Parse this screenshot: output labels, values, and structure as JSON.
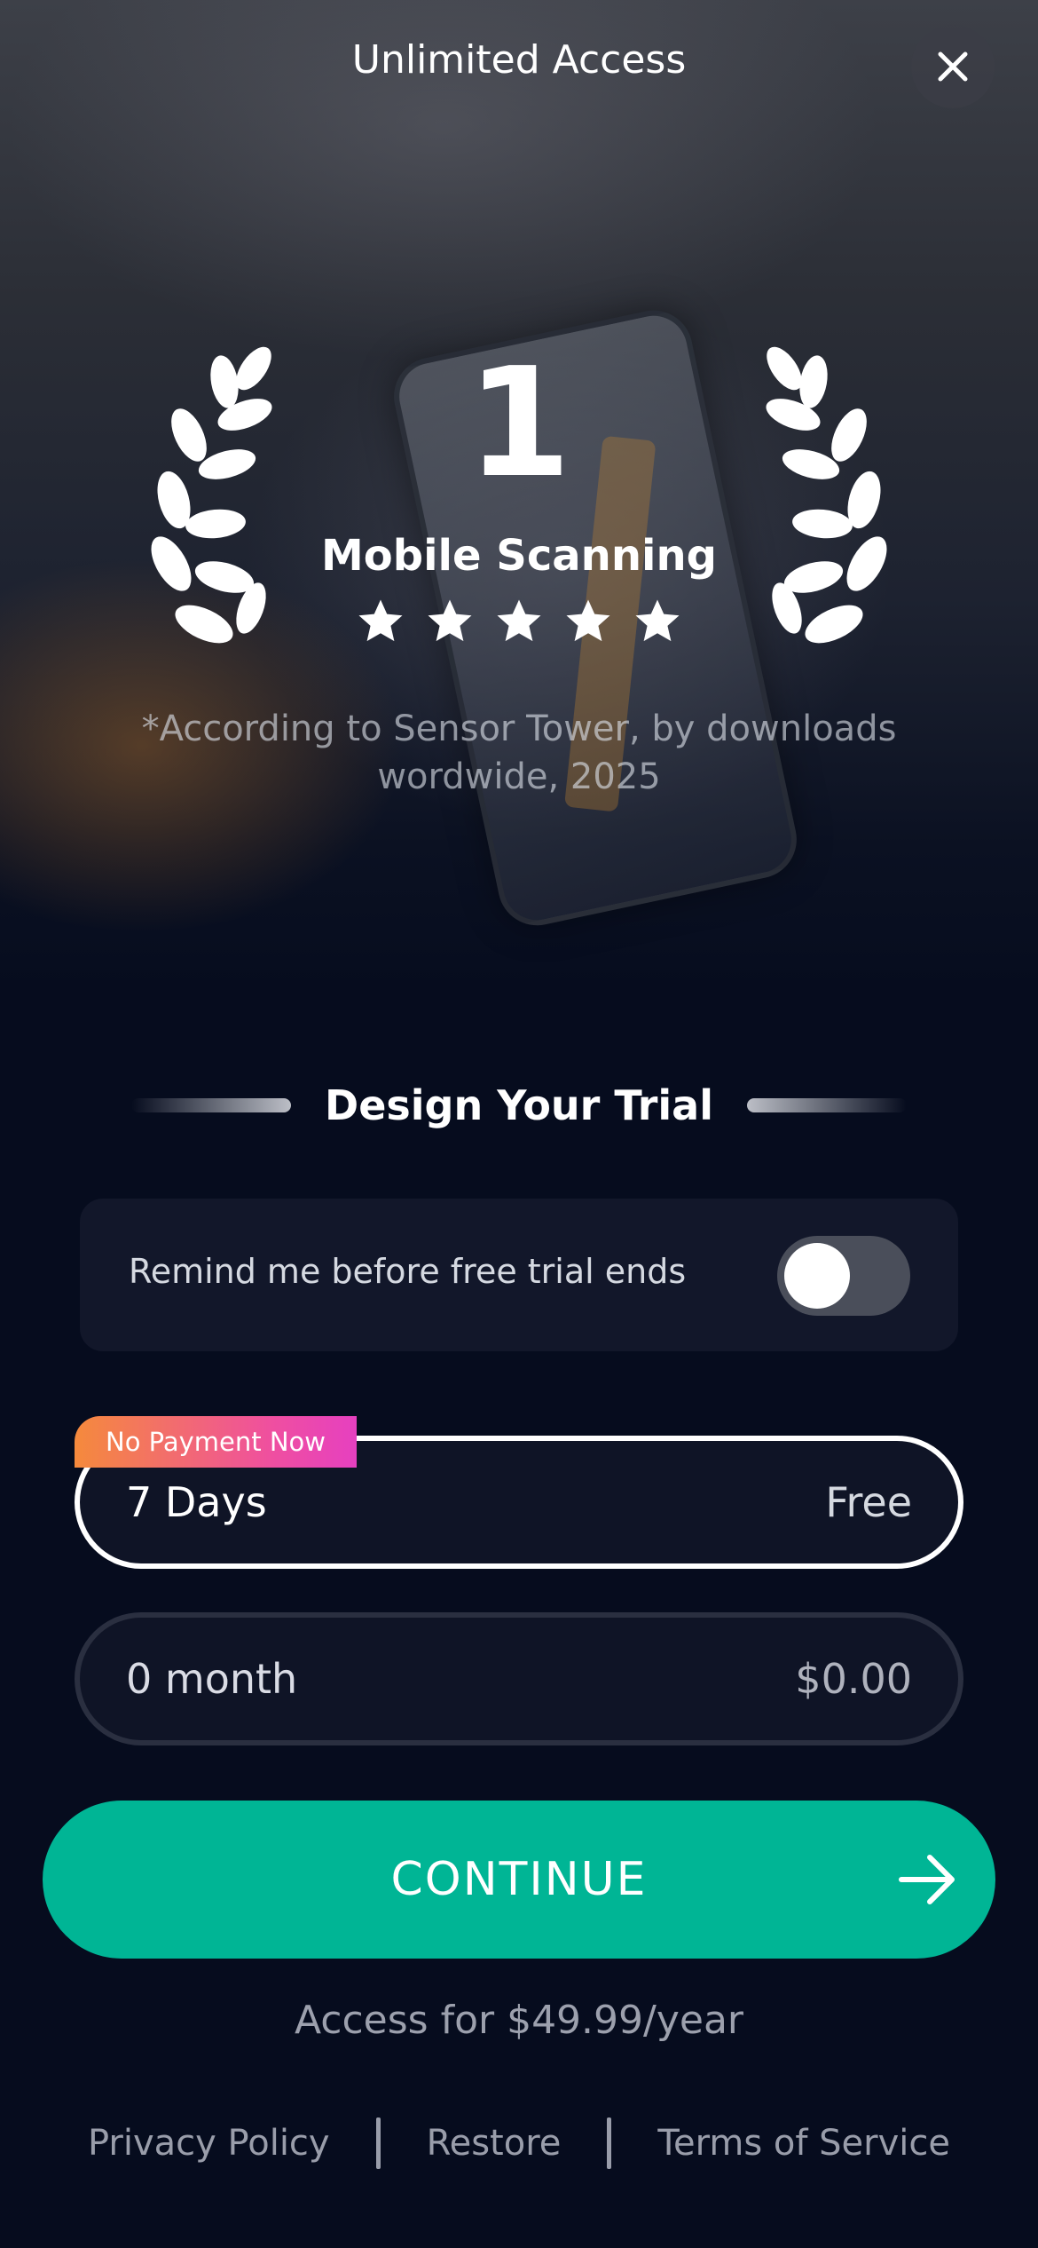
{
  "header": {
    "title": "Unlimited Access",
    "close_icon": "close-icon"
  },
  "award": {
    "rank": "1",
    "label": "Mobile Scanning",
    "rating_stars": 5,
    "source_note": "*According to Sensor Tower, by downloads wordwide, 2025",
    "laurel_icon": "laurel-icon"
  },
  "trial": {
    "section_title": "Design Your Trial",
    "reminder_label": "Remind me before free trial ends",
    "reminder_enabled": false
  },
  "plans": [
    {
      "badge": "No Payment Now",
      "name": "7 Days",
      "price": "Free",
      "selected": true
    },
    {
      "name": "0 month",
      "price": "$0.00",
      "selected": false
    }
  ],
  "cta": {
    "label": "CONTINUE",
    "icon": "arrow-right-icon"
  },
  "price_note": "Access for $49.99/year",
  "footer": {
    "privacy": "Privacy Policy",
    "restore": "Restore",
    "terms": "Terms of Service"
  },
  "colors": {
    "background": "#060c1e",
    "accent": "#00b595",
    "card": "#12172a",
    "badge_start": "#f58a3c",
    "badge_end": "#e640c0"
  }
}
